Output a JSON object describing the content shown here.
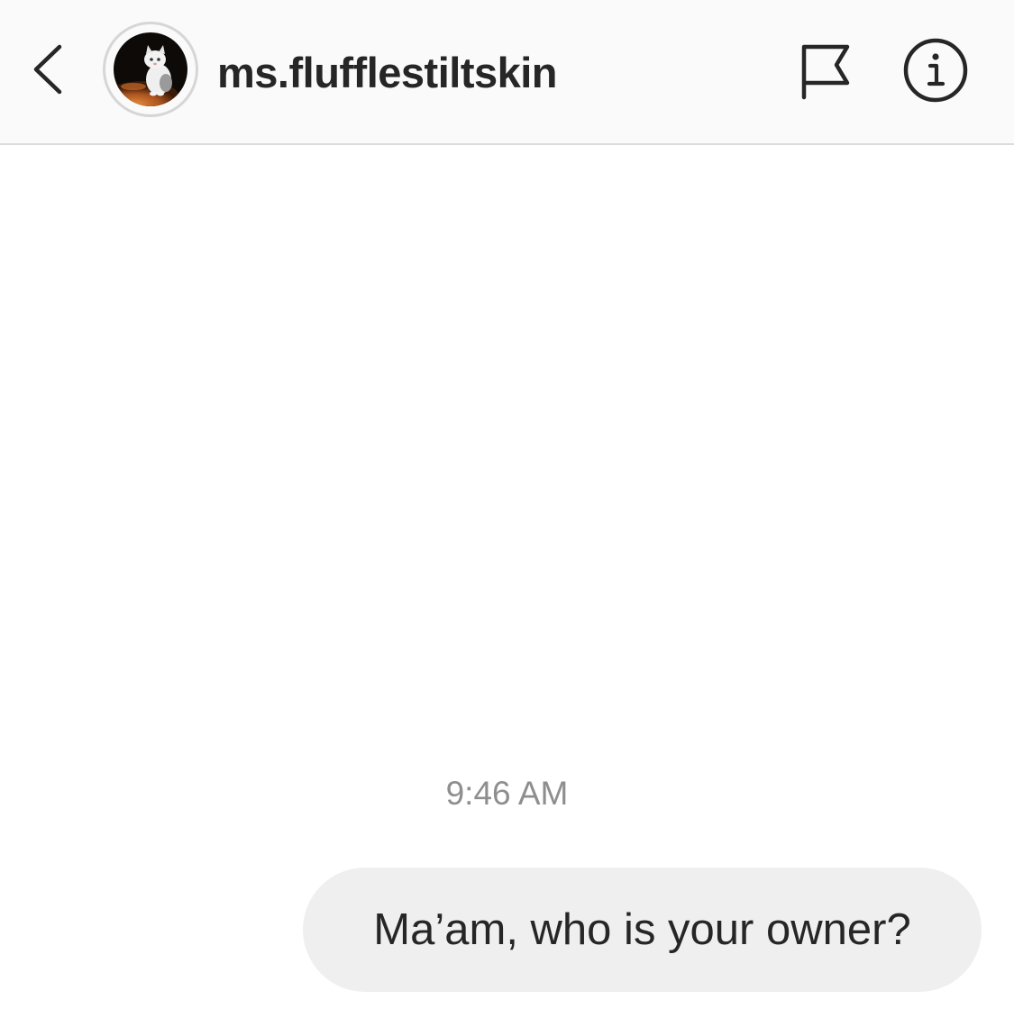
{
  "header": {
    "username": "ms.flufflestiltskin",
    "back_icon": "chevron-left-icon",
    "flag_icon": "flag-icon",
    "info_icon": "info-icon"
  },
  "conversation": {
    "timestamp": "9:46 AM",
    "messages": [
      {
        "sender": "me",
        "text": "Ma’am, who is your owner?"
      }
    ]
  },
  "colors": {
    "header_bg": "#fafafa",
    "divider": "#dbdbdb",
    "bubble_bg": "#efefef",
    "text": "#262626",
    "timestamp": "#8e8e8e"
  }
}
